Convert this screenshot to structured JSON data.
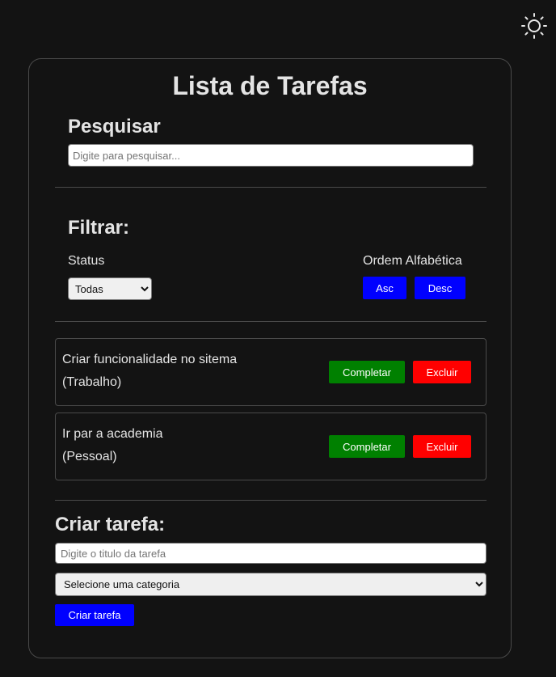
{
  "app": {
    "title": "Lista de Tarefas",
    "theme_icon": "sun-icon"
  },
  "search": {
    "heading": "Pesquisar",
    "placeholder": "Digite para pesquisar...",
    "value": ""
  },
  "filter": {
    "heading": "Filtrar:",
    "status_label": "Status",
    "status_selected": "Todas",
    "order_label": "Ordem Alfabética",
    "asc_label": "Asc",
    "desc_label": "Desc"
  },
  "tasks": [
    {
      "title": "Criar funcionalidade no sitema",
      "category": "(Trabalho)",
      "complete_label": "Completar",
      "delete_label": "Excluir"
    },
    {
      "title": "Ir par a academia",
      "category": "(Pessoal)",
      "complete_label": "Completar",
      "delete_label": "Excluir"
    }
  ],
  "create": {
    "heading": "Criar tarefa:",
    "title_placeholder": "Digite o titulo da tarefa",
    "category_selected": "Selecione uma categoria",
    "submit_label": "Criar tarefa"
  },
  "colors": {
    "background": "#131313",
    "primary_button": "#0000ff",
    "complete_button": "#008000",
    "delete_button": "#ff0000",
    "text": "#e4e4e4"
  }
}
